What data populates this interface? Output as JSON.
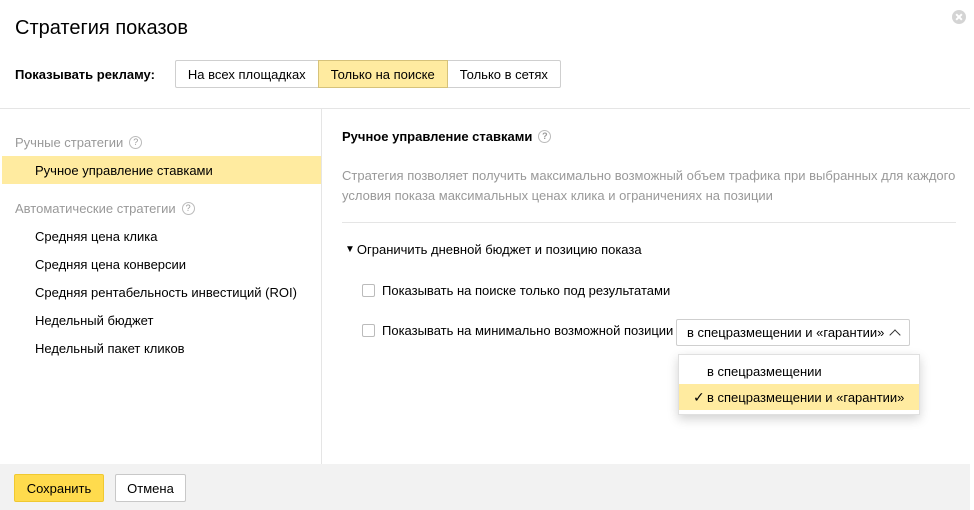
{
  "dialog": {
    "title": "Стратегия показов"
  },
  "show_ads": {
    "label": "Показывать рекламу:",
    "options": [
      "На всех площадках",
      "Только на поиске",
      "Только в сетях"
    ],
    "selected": "Только на поиске"
  },
  "sidebar": {
    "manual_title": "Ручные стратегии",
    "manual_items": [
      "Ручное управление ставками"
    ],
    "auto_title": "Автоматические стратегии",
    "auto_items": [
      "Средняя цена клика",
      "Средняя цена конверсии",
      "Средняя рентабельность инвестиций (ROI)",
      "Недельный бюджет",
      "Недельный пакет кликов"
    ],
    "help_glyph": "?"
  },
  "content": {
    "title": "Ручное управление ставками",
    "description": "Стратегия позволяет получить максимально возможный объем трафика при выбранных для каждого условия показа максимальных ценах клика и ограничениях на позиции",
    "toggle_glyph": "▼",
    "toggle_label": "Ограничить дневной бюджет и позицию показа",
    "checkbox_below_results": "Показывать на поиске только под результатами",
    "checkbox_min_position": "Показывать на минимально возможной позиции",
    "position_select": {
      "value": "в спецразмещении и «гарантии»",
      "options": [
        "в спецразмещении",
        "в спецразмещении и «гарантии»"
      ],
      "check_glyph": "✓"
    }
  },
  "footer": {
    "save_label": "Сохранить",
    "cancel_label": "Отмена"
  },
  "colors": {
    "accent": "#ffeba0",
    "primary_button": "#ffdb4d",
    "muted_text": "#999999"
  }
}
